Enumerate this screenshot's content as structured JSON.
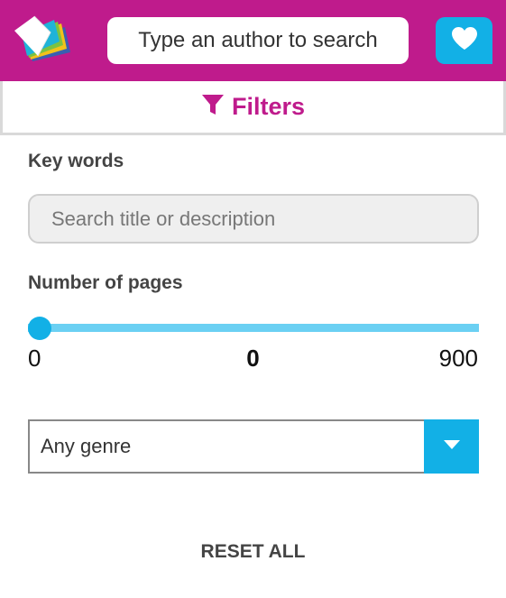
{
  "header": {
    "logo_icon": "book-pages-logo",
    "search_placeholder": "Type an author to search",
    "favorites_icon": "heart-icon",
    "brand_color": "#bf1b8c",
    "accent_color": "#12b0e6"
  },
  "filters": {
    "label": "Filters",
    "icon": "funnel-icon"
  },
  "keywords": {
    "label": "Key words",
    "placeholder": "Search title or description"
  },
  "pages": {
    "label": "Number of pages",
    "min_label": "0",
    "current_label": "0",
    "max_label": "900",
    "min": 0,
    "max": 900,
    "value": 0
  },
  "genre": {
    "selected": "Any genre",
    "icon": "caret-down-icon"
  },
  "reset_label": "RESET ALL"
}
